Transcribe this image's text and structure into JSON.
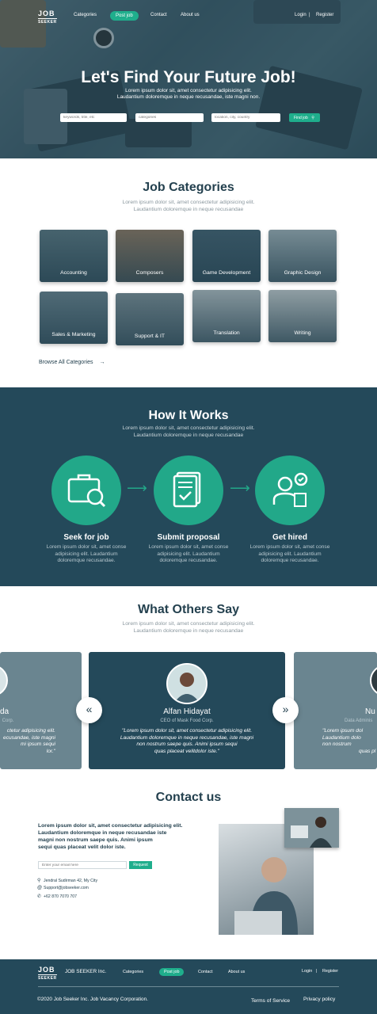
{
  "header": {
    "logo_main": "JOB",
    "logo_sub": "SEEKER",
    "nav": [
      "Categories",
      "Post job",
      "Contact",
      "About us"
    ],
    "login": "Login",
    "divider": "|",
    "register": "Register"
  },
  "hero": {
    "title": "Let's Find Your Future Job!",
    "subtitle_1": "Lorem ipsum dolor sit, amet consectetur adipisicing elit.",
    "subtitle_2": "Laudantium doloremque in neque recusandae, iste magni non.",
    "search_keywords_placeholder": "keywords, title, etc",
    "search_categories_placeholder": "categories",
    "search_location_placeholder": "location, city, country",
    "search_button": "Find job"
  },
  "categories": {
    "title": "Job Categories",
    "subtitle_1": "Lorem ipsum dolor sit, amet consectetur adipisicing elit.",
    "subtitle_2": "Laudantium doloremque in neque recusandae",
    "items": [
      {
        "label": "Accounting"
      },
      {
        "label": "Composers"
      },
      {
        "label": "Game Development"
      },
      {
        "label": "Graphic Design"
      },
      {
        "label": "Sales & Marketing"
      },
      {
        "label": "Support & IT"
      },
      {
        "label": "Translation"
      },
      {
        "label": "Writing"
      }
    ],
    "browse_all": "Browse All Categories",
    "browse_arrow": "→"
  },
  "how": {
    "title": "How It Works",
    "subtitle_1": "Lorem ipsum dolor sit, amet consectetur adipisicing elit.",
    "subtitle_2": "Laudantium doloremque in neque recusandae",
    "steps": [
      {
        "title": "Seek for job",
        "line1": "Lorem ipsum dolor sit, amet conse",
        "line2": "adipisicing elit. Laudantium",
        "line3": "doloremque recusandae."
      },
      {
        "title": "Submit proposal",
        "line1": "Lorem ipsum dolor sit, amet conse",
        "line2": "adipisicing elit. Laudantium",
        "line3": "doloremque recusandae."
      },
      {
        "title": "Get hired",
        "line1": "Lorem ipsum dolor sit, amet conse",
        "line2": "adipisicing elit. Laudantium",
        "line3": "doloremque recusandae."
      }
    ]
  },
  "testimonials": {
    "title": "What Others Say",
    "subtitle_1": "Lorem ipsum dolor sit, amet consectetur adipisicing elit.",
    "subtitle_2": "Laudantium doloremque in neque recusandae",
    "prev_icon": "«",
    "next_icon": "»",
    "left_card": {
      "name": "da",
      "role": "Corp.",
      "l1": "ctetur adipisicing elit.",
      "l2": "ecusandae, iste magni",
      "l3": "mi ipsum sequi",
      "l4": "lor.\""
    },
    "main_card": {
      "name": "Alfan Hidayat",
      "role": "CEO of Mask Food Corp.",
      "l1": "\"Lorem ipsum dolor sit, amet consectetur adipisicing elit.",
      "l2": "Laudantium doloremque in neque recusandae, iste magni",
      "l3": "non nostrum saepe quis. Animi ipsum sequi",
      "l4": "quas placeat velitdolor iste.\""
    },
    "right_card": {
      "name": "Nu",
      "role": "Data Adminis",
      "l1": "\"Lorem ipsum dol",
      "l2": "Laudantium dolo",
      "l3": "non nostrum",
      "l4": "quas pl"
    }
  },
  "contact": {
    "title": "Contact us",
    "text_1": "Lorem ipsum dolor sit, amet consectetur adipisicing elit.",
    "text_2": "Laudantium doloremque in neque recusandae iste",
    "text_3": "magni non nostrum saepe quis. Animi ipsum",
    "text_4": "sequi quas placeat velit dolor iste.",
    "email_placeholder": "Enter your email here",
    "request_button": "Request",
    "address": "Jendral Sudirman 42, My City",
    "email": "Support@jobseeker.com",
    "phone": "+62 870 7070 707"
  },
  "footer": {
    "logo_main": "JOB",
    "logo_sub": "SEEKER",
    "brand": "JOB SEEKER Inc.",
    "nav": [
      "Categories",
      "Post job",
      "Contact",
      "About us"
    ],
    "login": "Login",
    "divider": "|",
    "register": "Register",
    "copyright": "©2020 Job Seeker Inc. Job Vacancy Corporation.",
    "terms": "Terms of Service",
    "privacy": "Privacy policy"
  },
  "colors": {
    "primary": "#24495a",
    "accent": "#1fae8c",
    "heading": "#24414f"
  }
}
